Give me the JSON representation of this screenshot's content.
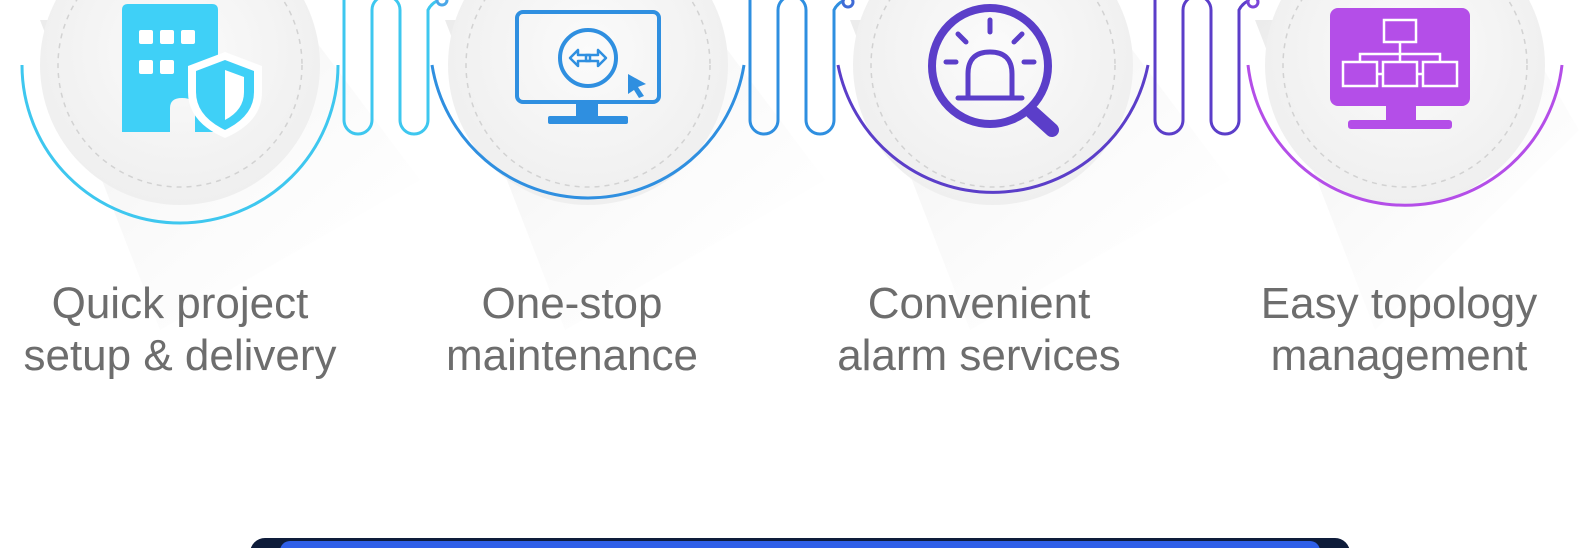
{
  "features": [
    {
      "id": "setup",
      "label_line1": "Quick project",
      "label_line2": "setup & delivery",
      "icon": "building-shield-icon",
      "color": "#3ec7ef"
    },
    {
      "id": "maintenance",
      "label_line1": "One-stop",
      "label_line2": "maintenance",
      "icon": "monitor-remote-control-icon",
      "color": "#2f8fe0"
    },
    {
      "id": "alarm",
      "label_line1": "Convenient",
      "label_line2": "alarm services",
      "icon": "alarm-search-icon",
      "color": "#5b3ec9"
    },
    {
      "id": "topology",
      "label_line1": "Easy topology",
      "label_line2": "management",
      "icon": "topology-monitor-icon",
      "color": "#b44ee8"
    }
  ],
  "colors": {
    "label_text": "#6d6d6d",
    "circle_fill": "#f4f4f4",
    "bottom_bar": "#2f5fe8"
  }
}
